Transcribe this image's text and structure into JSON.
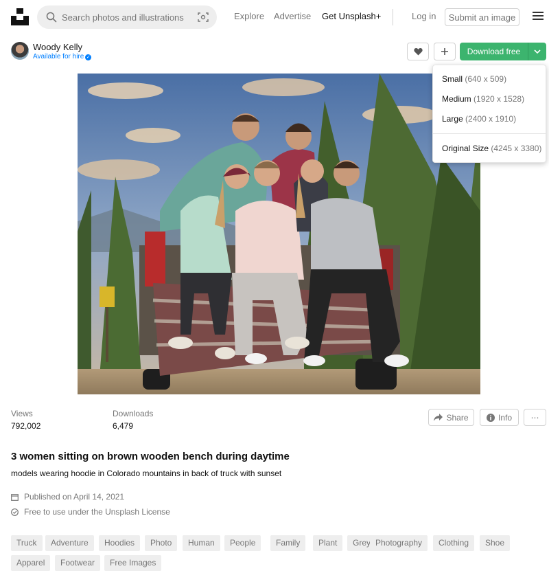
{
  "nav": {
    "search_placeholder": "Search photos and illustrations",
    "explore": "Explore",
    "advertise": "Advertise",
    "get_plus": "Get Unsplash+",
    "login": "Log in",
    "submit": "Submit an image"
  },
  "author": {
    "name": "Woody Kelly",
    "status": "Available for hire"
  },
  "actions": {
    "download": "Download free"
  },
  "download_menu": [
    {
      "name": "Small",
      "dims": "(640 x 509)"
    },
    {
      "name": "Medium",
      "dims": "(1920 x 1528)"
    },
    {
      "name": "Large",
      "dims": "(2400 x 1910)"
    },
    {
      "name": "Original Size",
      "dims": "(4245 x 3380)"
    }
  ],
  "stats": {
    "views_label": "Views",
    "views": "792,002",
    "downloads_label": "Downloads",
    "downloads": "6,479"
  },
  "buttons": {
    "share": "Share",
    "info": "Info",
    "more": "⋯"
  },
  "photo": {
    "title": "3 women sitting on brown wooden bench during daytime",
    "description": "models wearing hoodie in Colorado mountains in back of truck with sunset",
    "published": "Published on April 14, 2021",
    "license": "Free to use under the Unsplash License"
  },
  "tags": [
    "Truck",
    "Adventure",
    "Hoodies",
    "Photo",
    "Human",
    "People",
    "Family",
    "Plant",
    "Grey",
    "Photography",
    "Clothing",
    "Shoe",
    "Apparel",
    "Footwear",
    "Free Images"
  ],
  "colors": {
    "accent_green": "#3cb46e",
    "link_blue": "#007fff"
  }
}
